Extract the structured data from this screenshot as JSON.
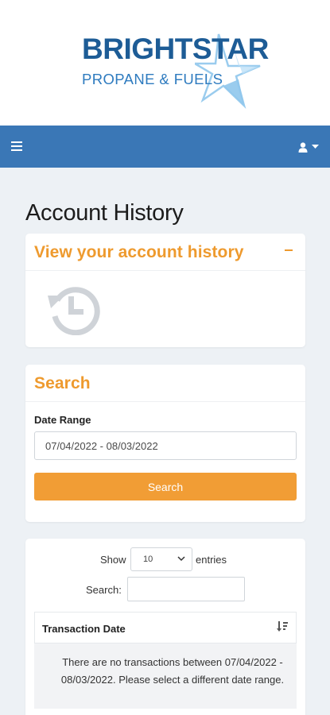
{
  "brand": {
    "name_top": "BRIGHTSTAR",
    "name_bottom": "PROPANE & FUELS",
    "primary_color": "#1d5c96",
    "secondary_color": "#2e7bbf"
  },
  "navbar": {
    "background": "#3a77b6",
    "menu_icon": "hamburger-icon",
    "user_icon": "user-icon",
    "caret_icon": "caret-down-icon"
  },
  "page": {
    "title": "Account History"
  },
  "history_card": {
    "title": "View your account history",
    "collapse_icon": "minus-icon",
    "icon": "history-icon"
  },
  "search_card": {
    "title": "Search",
    "date_range_label": "Date Range",
    "date_range_value": "07/04/2022 - 08/03/2022",
    "search_button": "Search",
    "accent_color": "#f19d35"
  },
  "table": {
    "show_label": "Show",
    "entries_value": "10",
    "entries_label": "entries",
    "search_label": "Search:",
    "search_value": "",
    "columns": [
      "Transaction Date"
    ],
    "sort_icon": "sort-amount-down-icon",
    "empty_message": "There are no transactions between 07/04/2022 - 08/03/2022. Please select a different date range."
  }
}
